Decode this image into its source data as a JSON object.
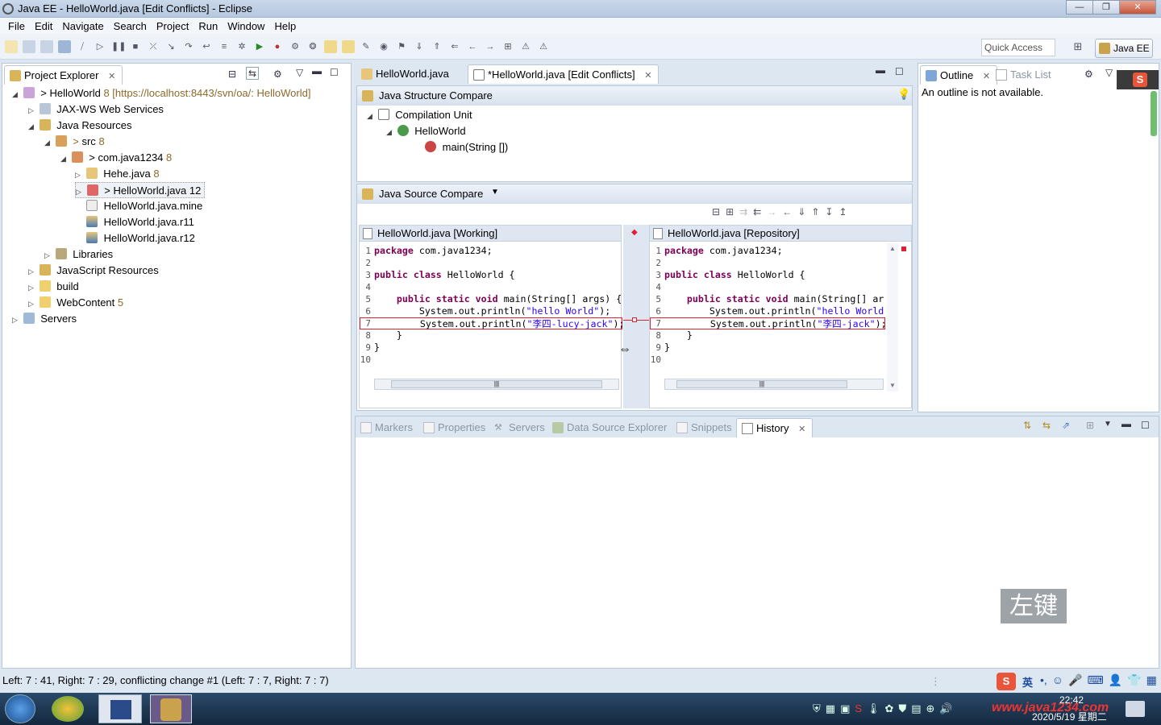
{
  "window": {
    "title": "Java EE - HelloWorld.java [Edit Conflicts] - Eclipse",
    "buttons": [
      "—",
      "❐",
      "✕"
    ]
  },
  "menu": [
    "File",
    "Edit",
    "Navigate",
    "Search",
    "Project",
    "Run",
    "Window",
    "Help"
  ],
  "toolbar": {
    "quick_access": "Quick Access",
    "perspective": "Java EE",
    "open_perspective_icon": "open-perspective-icon"
  },
  "project_explorer": {
    "tab_label": "Project Explorer",
    "close": "✕",
    "tree": [
      {
        "label": "HelloWorld",
        "decoration": "8 [https://localhost:8443/svn/oa/: HelloWorld]",
        "prefix": "> ",
        "twisty": "◢",
        "icon": "project-icon"
      },
      {
        "label": "JAX-WS Web Services",
        "decoration": "",
        "prefix": "",
        "twisty": "▷",
        "icon": "webservice-icon"
      },
      {
        "label": "Java Resources",
        "decoration": "",
        "prefix": "",
        "twisty": "◢",
        "icon": "java-resources-icon"
      },
      {
        "label": "src",
        "decoration": "8",
        "prefix": "> ",
        "twisty": "◢",
        "icon": "source-folder-icon"
      },
      {
        "label": "com.java1234",
        "decoration": "8",
        "prefix": "> ",
        "twisty": "◢",
        "icon": "package-icon"
      },
      {
        "label": "Hehe.java",
        "decoration": "8",
        "prefix": "",
        "twisty": "▷",
        "icon": "java-file-icon"
      },
      {
        "label": "HelloWorld.java 12",
        "decoration": "",
        "prefix": "> ",
        "twisty": "▷",
        "icon": "java-conflict-file-icon"
      },
      {
        "label": "HelloWorld.java.mine",
        "decoration": "",
        "prefix": "",
        "twisty": "",
        "icon": "text-file-icon"
      },
      {
        "label": "HelloWorld.java.r11",
        "decoration": "",
        "prefix": "",
        "twisty": "",
        "icon": "revision-file-icon"
      },
      {
        "label": "HelloWorld.java.r12",
        "decoration": "",
        "prefix": "",
        "twisty": "",
        "icon": "revision-file-icon"
      },
      {
        "label": "Libraries",
        "decoration": "",
        "prefix": "",
        "twisty": "▷",
        "icon": "libraries-icon"
      },
      {
        "label": "JavaScript Resources",
        "decoration": "",
        "prefix": "",
        "twisty": "▷",
        "icon": "javascript-resources-icon"
      },
      {
        "label": "build",
        "decoration": "",
        "prefix": "",
        "twisty": "▷",
        "icon": "folder-icon"
      },
      {
        "label": "WebContent",
        "decoration": "5",
        "prefix": "",
        "twisty": "▷",
        "icon": "folder-icon"
      },
      {
        "label": "Servers",
        "decoration": "",
        "prefix": "",
        "twisty": "▷",
        "icon": "servers-folder-icon"
      }
    ]
  },
  "editor": {
    "tabs": [
      {
        "label": "HelloWorld.java",
        "active": false
      },
      {
        "label": "*HelloWorld.java [Edit Conflicts]",
        "active": true
      }
    ],
    "structure_compare": {
      "title": "Java Structure Compare",
      "tree": [
        "Compilation Unit",
        "HelloWorld",
        "main(String [])"
      ]
    },
    "source_compare": {
      "title": "Java Source Compare",
      "left_title": "HelloWorld.java [Working]",
      "right_title": "HelloWorld.java [Repository]",
      "line_numbers": [
        "1",
        "2",
        "3",
        "4",
        "5",
        "6",
        "7",
        "8",
        "9",
        "10"
      ],
      "left_lines": [
        "package com.java1234;",
        "",
        "public class HelloWorld {",
        "",
        "    public static void main(String[] args) {",
        "        System.out.println(\"hello World\");",
        "        System.out.println(\"李四-lucy-jack\");",
        "    }",
        "}",
        ""
      ],
      "right_lines": [
        "package com.java1234;",
        "",
        "public class HelloWorld {",
        "",
        "    public static void main(String[] ar",
        "        System.out.println(\"hello World",
        "        System.out.println(\"李四-jack\");",
        "    }",
        "}",
        ""
      ]
    }
  },
  "outline": {
    "tabs": [
      "Outline",
      "Task List"
    ],
    "message": "An outline is not available."
  },
  "bottom_panel": {
    "tabs": [
      "Markers",
      "Properties",
      "Servers",
      "Data Source Explorer",
      "Snippets",
      "History"
    ],
    "active": "History"
  },
  "status": "Left: 7 : 41, Right: 7 : 29, conflicting change #1 (Left: 7 : 7, Right: 7 : 7)",
  "overlay_label": "左键",
  "taskbar": {
    "time": "22:42",
    "date": "2020/5/19 星期二",
    "ime": "英",
    "watermark": "www.java1234.com"
  }
}
